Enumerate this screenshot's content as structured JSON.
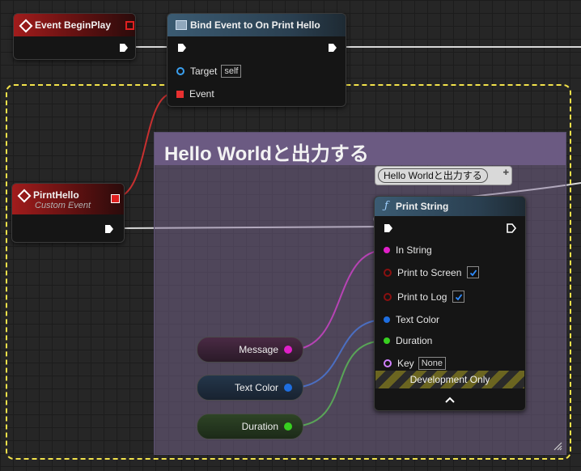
{
  "nodes": {
    "begin_play": {
      "title": "Event BeginPlay"
    },
    "bind_event": {
      "title": "Bind Event to On Print Hello",
      "pin_target": "Target",
      "target_value": "self",
      "pin_event": "Event"
    },
    "custom_event": {
      "title": "PirntHello",
      "subtitle": "Custom Event"
    },
    "print_string": {
      "title": "Print String",
      "tooltip": "Hello Worldと出力する",
      "pins": {
        "in_string": "In String",
        "print_to_screen": "Print to Screen",
        "print_to_log": "Print to Log",
        "text_color": "Text Color",
        "duration": "Duration",
        "key": "Key",
        "key_value": "None"
      },
      "print_to_screen_checked": true,
      "print_to_log_checked": true,
      "dev_only": "Development Only"
    },
    "variables": {
      "message": "Message",
      "text_color": "Text Color",
      "duration": "Duration"
    }
  },
  "comment": {
    "title": "Hello Worldと出力する"
  },
  "colors": {
    "exec": "#ffffff",
    "string_pin": "#e020c8",
    "bool_pin": "#8a1010",
    "struct_pin": "#1e6ee0",
    "float_pin": "#38d020",
    "key_pin": "#d080ff",
    "delegate_pin": "#e83030",
    "selection": "#f2e24a"
  },
  "icons": {
    "event": "diamond-icon",
    "function": "function-f-icon",
    "expand": "chevron-up-icon"
  }
}
